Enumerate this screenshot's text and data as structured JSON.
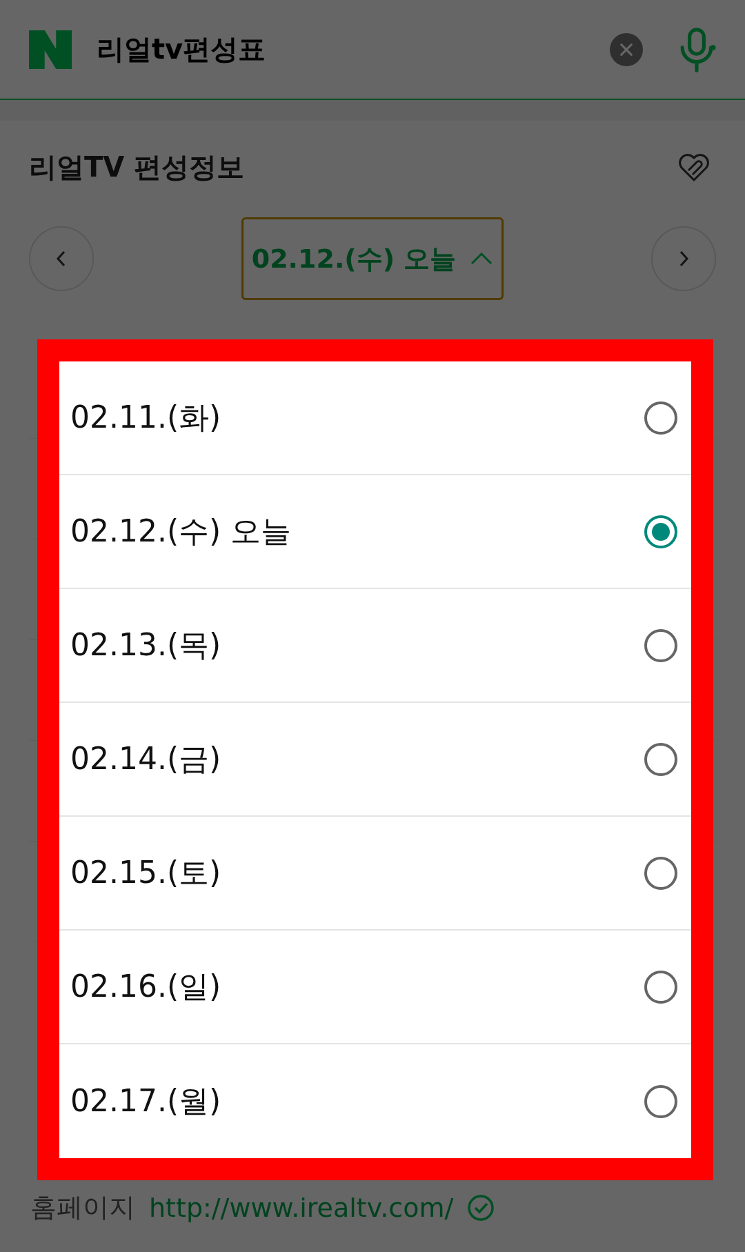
{
  "header": {
    "title": "리얼tv편성표"
  },
  "section": {
    "title": "리얼TV 편성정보"
  },
  "date_picker": {
    "label": "02.12.(수) 오늘",
    "expanded": true
  },
  "dropdown": {
    "options": [
      {
        "label": "02.11.(화)",
        "selected": false
      },
      {
        "label": "02.12.(수) 오늘",
        "selected": true
      },
      {
        "label": "02.13.(목)",
        "selected": false
      },
      {
        "label": "02.14.(금)",
        "selected": false
      },
      {
        "label": "02.15.(토)",
        "selected": false
      },
      {
        "label": "02.16.(일)",
        "selected": false
      },
      {
        "label": "02.17.(월)",
        "selected": false
      }
    ]
  },
  "homepage": {
    "label": "홈페이지",
    "url": "http://www.irealtv.com/"
  }
}
